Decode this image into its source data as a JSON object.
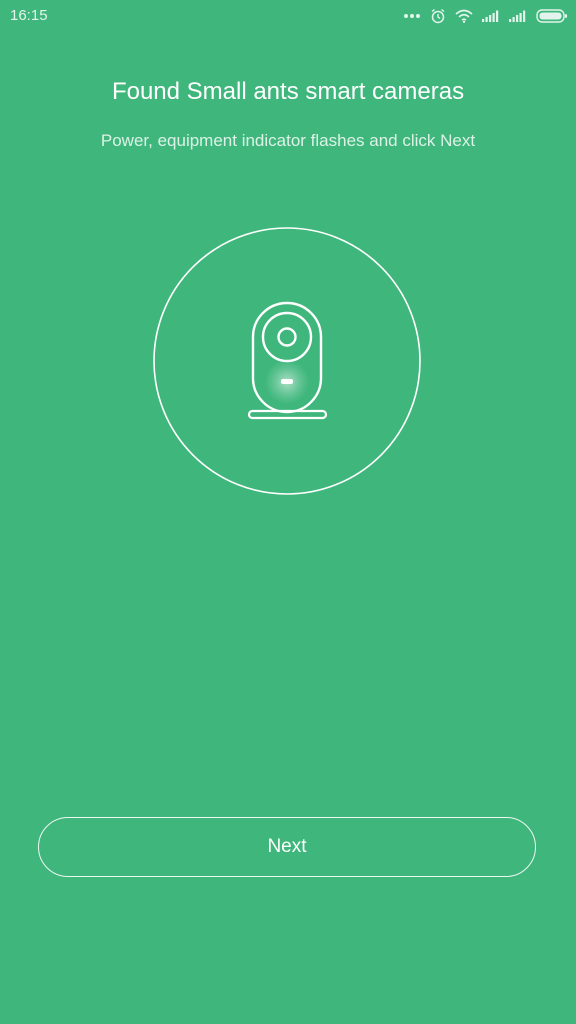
{
  "status_bar": {
    "time": "16:15",
    "icons": [
      "more-dots-icon",
      "alarm-icon",
      "wifi-icon",
      "signal-icon",
      "signal-icon",
      "battery-icon"
    ]
  },
  "content": {
    "title": "Found Small ants smart cameras",
    "subtitle": "Power, equipment indicator flashes and click Next",
    "illustration_icon": "smart-camera-icon"
  },
  "actions": {
    "next_label": "Next"
  },
  "colors": {
    "background": "#3fb77c",
    "foreground": "#ffffff"
  }
}
